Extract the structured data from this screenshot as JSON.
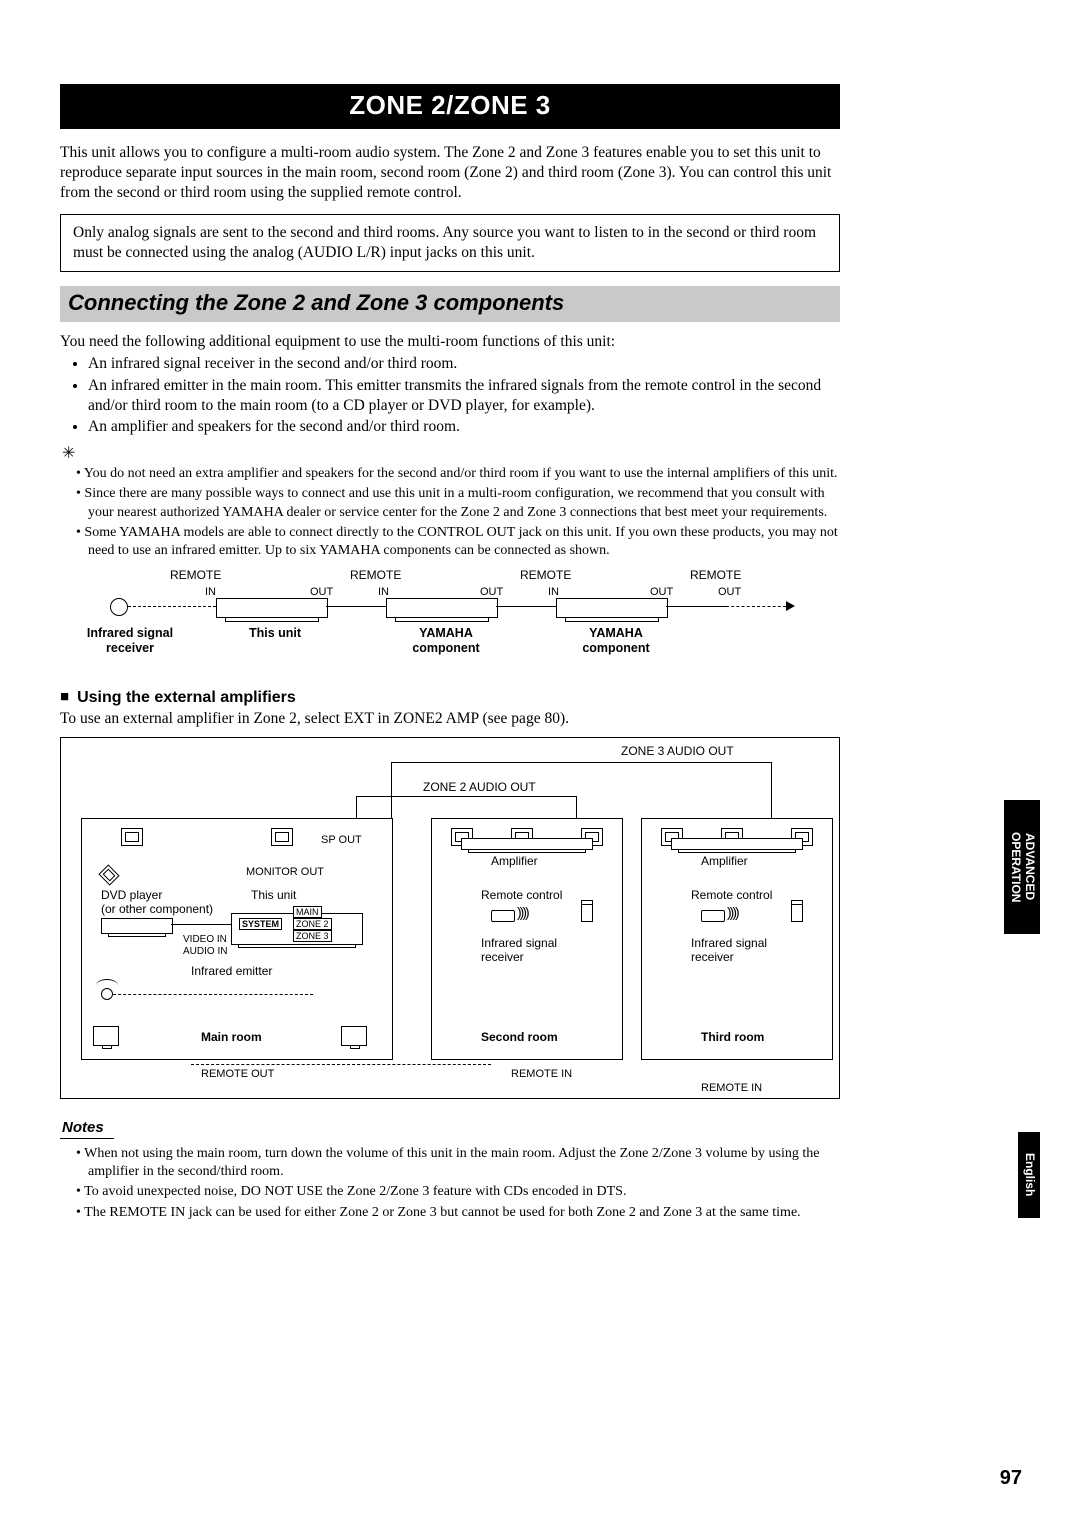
{
  "title": "ZONE 2/ZONE 3",
  "intro": "This unit allows you to configure a multi-room audio system. The Zone 2 and Zone 3 features enable you to set this unit to reproduce separate input sources in the main room, second room (Zone 2) and third room (Zone 3). You can control this unit from the second or third room using the supplied remote control.",
  "info_box": "Only analog signals are sent to the second and third rooms. Any source you want to listen to in the second or third room must be connected using the analog (AUDIO L/R) input jacks on this unit.",
  "section_heading": "Connecting the Zone 2 and Zone 3 components",
  "equip_intro": "You need the following additional equipment to use the multi-room functions of this unit:",
  "equip_list": [
    "An infrared signal receiver in the second and/or third room.",
    "An infrared emitter in the main room. This emitter transmits the infrared signals from the remote control in the second and/or third room to the main room (to a CD player or DVD player, for example).",
    "An amplifier and speakers for the second and/or third room."
  ],
  "hints": [
    "You do not need an extra amplifier and speakers for the second and/or third room if you want to use the internal amplifiers of this unit.",
    "Since there are many possible ways to connect and use this unit in a multi-room configuration, we recommend that you consult with your nearest authorized YAMAHA dealer or service center for the Zone 2 and Zone 3 connections that best meet your requirements.",
    "Some YAMAHA models are able to connect directly to the CONTROL OUT jack on this unit. If you own these products, you may not need to use an infrared emitter. Up to six YAMAHA components can be connected as shown."
  ],
  "diagram1": {
    "remote": "REMOTE",
    "in": "IN",
    "out": "OUT",
    "cap_receiver": "Infrared signal\nreceiver",
    "cap_unit": "This unit",
    "cap_comp": "YAMAHA\ncomponent"
  },
  "sub_heading": "Using the external amplifiers",
  "sub_text": "To use an external amplifier in Zone 2, select EXT in ZONE2 AMP (see page 80).",
  "diagram2": {
    "zone3_out": "ZONE 3 AUDIO OUT",
    "zone2_out": "ZONE 2 AUDIO OUT",
    "sp_out": "SP OUT",
    "monitor_out": "MONITOR OUT",
    "dvd": "DVD player\n(or other component)",
    "this_unit": "This unit",
    "system": "SYSTEM",
    "main_tag": "MAIN",
    "zone2_tag": "ZONE 2",
    "zone3_tag": "ZONE 3",
    "video_in": "VIDEO IN",
    "audio_in": "AUDIO IN",
    "ir_emitter": "Infrared emitter",
    "main_room": "Main room",
    "remote_out": "REMOTE OUT",
    "amplifier": "Amplifier",
    "remote_control": "Remote control",
    "ir_receiver": "Infrared signal\nreceiver",
    "second_room": "Second room",
    "third_room": "Third room",
    "remote_in": "REMOTE IN"
  },
  "notes_label": "Notes",
  "notes": [
    "When not using the main room, turn down the volume of this unit in the main room. Adjust the Zone 2/Zone 3 volume by using the amplifier in the second/third room.",
    "To avoid unexpected noise, DO NOT USE the Zone 2/Zone 3 feature with CDs encoded in DTS.",
    "The REMOTE IN jack can be used for either Zone 2 or Zone 3 but cannot be used for both Zone 2 and Zone 3 at the same time."
  ],
  "side_tab_adv": "ADVANCED\nOPERATION",
  "side_tab_eng": "English",
  "page_number": "97"
}
